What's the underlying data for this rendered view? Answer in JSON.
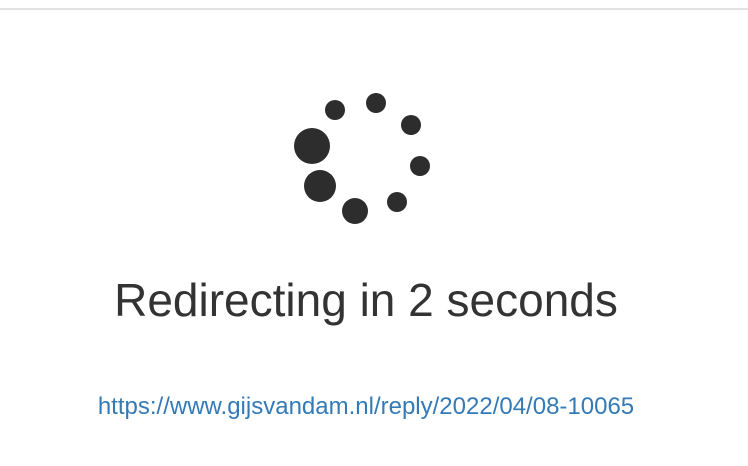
{
  "status": {
    "message": "Redirecting in 2 seconds",
    "redirect_url": "https://www.gijsvandam.nl/reply/2022/04/08-10065"
  },
  "colors": {
    "spinner": "#2d2d2d",
    "text": "#333333",
    "link": "#337ab7",
    "rule": "#e2e2e2"
  },
  "icons": {
    "spinner": "loading-spinner-icon"
  }
}
